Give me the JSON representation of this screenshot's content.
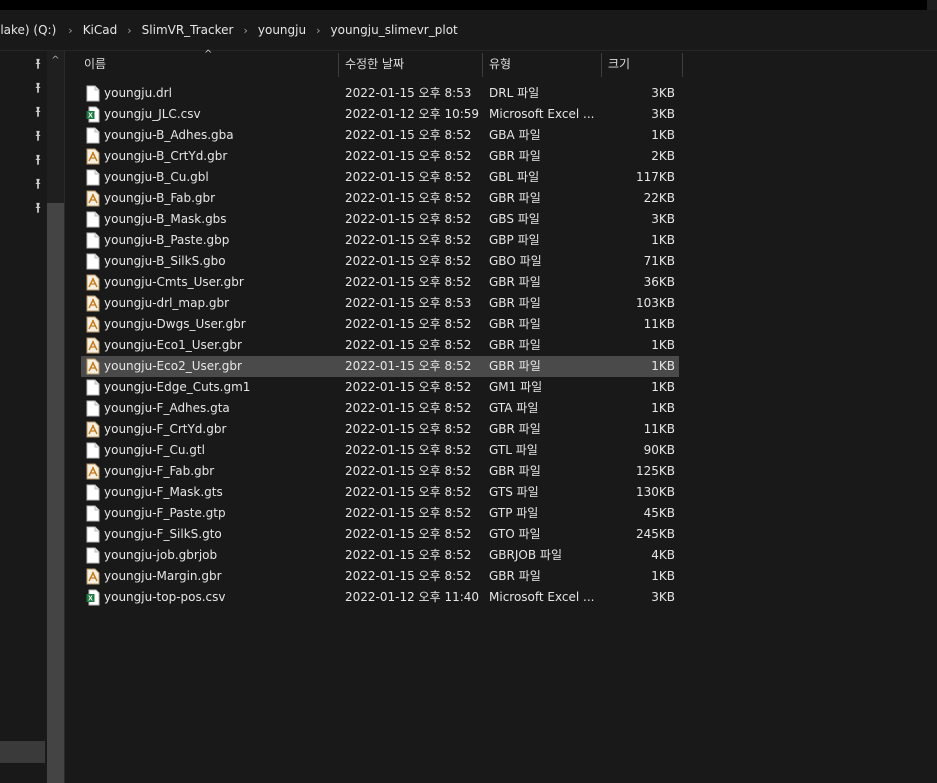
{
  "address": {
    "crumbs": [
      "ilake) (Q:)",
      "KiCad",
      "SlimVR_Tracker",
      "youngju",
      "youngju_slimevr_plot"
    ],
    "separator_glyph": "›"
  },
  "nav": {
    "pin_glyph": "📌",
    "scroll_up_glyph": "^",
    "pinned_count": 7
  },
  "columns": {
    "name": "이름",
    "date": "수정한 날짜",
    "type": "유형",
    "size": "크기"
  },
  "files": [
    {
      "name": "youngju.drl",
      "date": "2022-01-15 오후 8:53",
      "type": "DRL 파일",
      "size": "3KB",
      "icon": "blank-file-icon"
    },
    {
      "name": "youngju_JLC.csv",
      "date": "2022-01-12 오후 10:59",
      "type": "Microsoft Excel ...",
      "size": "3KB",
      "icon": "excel-csv-icon"
    },
    {
      "name": "youngju-B_Adhes.gba",
      "date": "2022-01-15 오후 8:52",
      "type": "GBA 파일",
      "size": "1KB",
      "icon": "blank-file-icon"
    },
    {
      "name": "youngju-B_CrtYd.gbr",
      "date": "2022-01-15 오후 8:52",
      "type": "GBR 파일",
      "size": "2KB",
      "icon": "gerber-file-icon"
    },
    {
      "name": "youngju-B_Cu.gbl",
      "date": "2022-01-15 오후 8:52",
      "type": "GBL 파일",
      "size": "117KB",
      "icon": "blank-file-icon"
    },
    {
      "name": "youngju-B_Fab.gbr",
      "date": "2022-01-15 오후 8:52",
      "type": "GBR 파일",
      "size": "22KB",
      "icon": "gerber-file-icon"
    },
    {
      "name": "youngju-B_Mask.gbs",
      "date": "2022-01-15 오후 8:52",
      "type": "GBS 파일",
      "size": "3KB",
      "icon": "blank-file-icon"
    },
    {
      "name": "youngju-B_Paste.gbp",
      "date": "2022-01-15 오후 8:52",
      "type": "GBP 파일",
      "size": "1KB",
      "icon": "blank-file-icon"
    },
    {
      "name": "youngju-B_SilkS.gbo",
      "date": "2022-01-15 오후 8:52",
      "type": "GBO 파일",
      "size": "71KB",
      "icon": "blank-file-icon"
    },
    {
      "name": "youngju-Cmts_User.gbr",
      "date": "2022-01-15 오후 8:52",
      "type": "GBR 파일",
      "size": "36KB",
      "icon": "gerber-file-icon"
    },
    {
      "name": "youngju-drl_map.gbr",
      "date": "2022-01-15 오후 8:53",
      "type": "GBR 파일",
      "size": "103KB",
      "icon": "gerber-file-icon"
    },
    {
      "name": "youngju-Dwgs_User.gbr",
      "date": "2022-01-15 오후 8:52",
      "type": "GBR 파일",
      "size": "11KB",
      "icon": "gerber-file-icon"
    },
    {
      "name": "youngju-Eco1_User.gbr",
      "date": "2022-01-15 오후 8:52",
      "type": "GBR 파일",
      "size": "1KB",
      "icon": "gerber-file-icon"
    },
    {
      "name": "youngju-Eco2_User.gbr",
      "date": "2022-01-15 오후 8:52",
      "type": "GBR 파일",
      "size": "1KB",
      "icon": "gerber-file-icon",
      "selected": true
    },
    {
      "name": "youngju-Edge_Cuts.gm1",
      "date": "2022-01-15 오후 8:52",
      "type": "GM1 파일",
      "size": "1KB",
      "icon": "blank-file-icon"
    },
    {
      "name": "youngju-F_Adhes.gta",
      "date": "2022-01-15 오후 8:52",
      "type": "GTA 파일",
      "size": "1KB",
      "icon": "blank-file-icon"
    },
    {
      "name": "youngju-F_CrtYd.gbr",
      "date": "2022-01-15 오후 8:52",
      "type": "GBR 파일",
      "size": "11KB",
      "icon": "gerber-file-icon"
    },
    {
      "name": "youngju-F_Cu.gtl",
      "date": "2022-01-15 오후 8:52",
      "type": "GTL 파일",
      "size": "90KB",
      "icon": "blank-file-icon"
    },
    {
      "name": "youngju-F_Fab.gbr",
      "date": "2022-01-15 오후 8:52",
      "type": "GBR 파일",
      "size": "125KB",
      "icon": "gerber-file-icon"
    },
    {
      "name": "youngju-F_Mask.gts",
      "date": "2022-01-15 오후 8:52",
      "type": "GTS 파일",
      "size": "130KB",
      "icon": "blank-file-icon"
    },
    {
      "name": "youngju-F_Paste.gtp",
      "date": "2022-01-15 오후 8:52",
      "type": "GTP 파일",
      "size": "45KB",
      "icon": "blank-file-icon"
    },
    {
      "name": "youngju-F_SilkS.gto",
      "date": "2022-01-15 오후 8:52",
      "type": "GTO 파일",
      "size": "245KB",
      "icon": "blank-file-icon"
    },
    {
      "name": "youngju-job.gbrjob",
      "date": "2022-01-15 오후 8:52",
      "type": "GBRJOB 파일",
      "size": "4KB",
      "icon": "blank-file-icon"
    },
    {
      "name": "youngju-Margin.gbr",
      "date": "2022-01-15 오후 8:52",
      "type": "GBR 파일",
      "size": "1KB",
      "icon": "gerber-file-icon"
    },
    {
      "name": "youngju-top-pos.csv",
      "date": "2022-01-12 오후 11:40",
      "type": "Microsoft Excel ...",
      "size": "3KB",
      "icon": "excel-csv-icon"
    }
  ]
}
